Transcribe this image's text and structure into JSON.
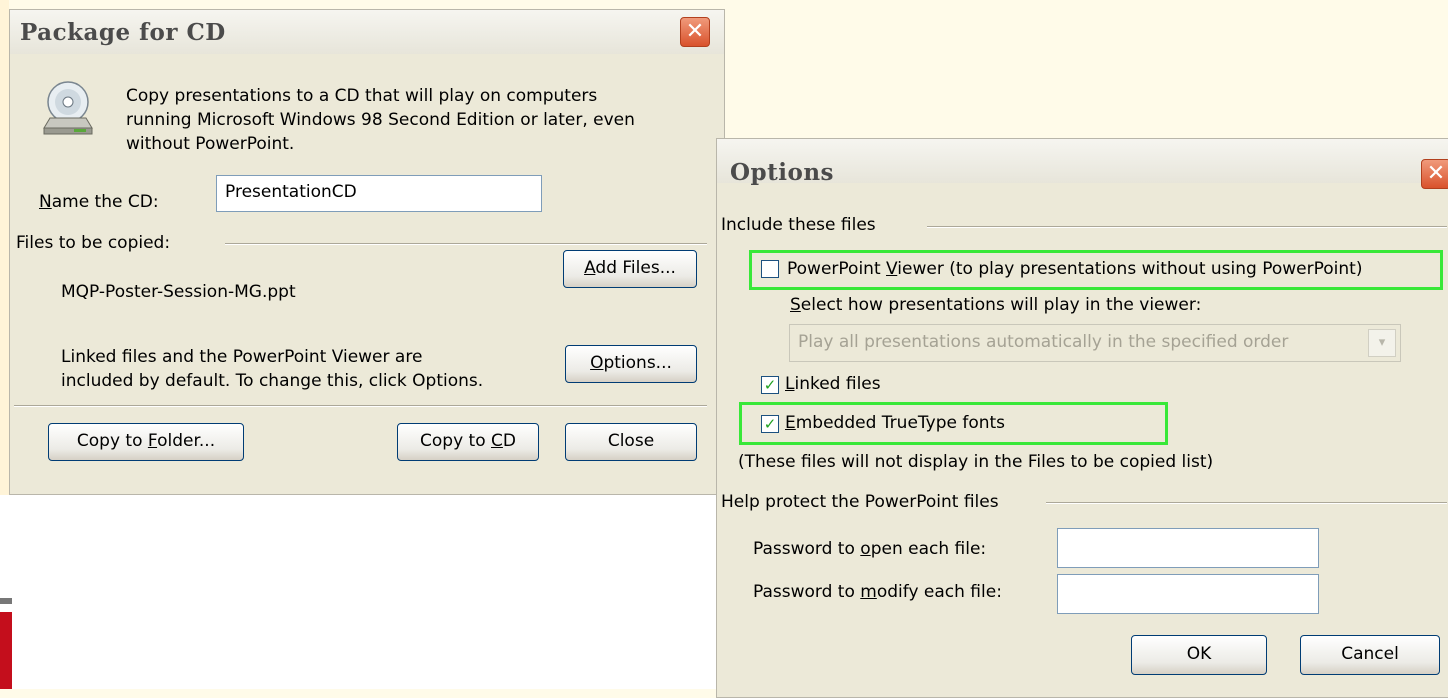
{
  "package_dialog": {
    "title": "Package for CD",
    "close_glyph": "✕",
    "icon": "cd-drive-icon",
    "description_line1": "Copy presentations to a CD that will play on computers",
    "description_line2": "running Microsoft Windows 98 Second Edition or later, even",
    "description_line3": "without PowerPoint.",
    "name_label_u": "N",
    "name_label_rest": "ame the CD:",
    "name_value": "PresentationCD",
    "files_label": "Files to be copied:",
    "file_name": "MQP-Poster-Session-MG.ppt",
    "add_files_u": "A",
    "add_files_rest": "dd Files...",
    "linked_info_line1": "Linked files and the PowerPoint Viewer are",
    "linked_info_line2": "included by default. To change this, click Options.",
    "options_u": "O",
    "options_rest": "ptions...",
    "copy_folder_pre": "Copy to ",
    "copy_folder_u": "F",
    "copy_folder_post": "older...",
    "copy_cd_pre": "Copy to ",
    "copy_cd_u": "C",
    "copy_cd_post": "D",
    "close_label": "Close"
  },
  "options_dialog": {
    "title": "Options",
    "close_glyph": "✕",
    "include_group": "Include these files",
    "viewer_pre": "PowerPoint ",
    "viewer_u": "V",
    "viewer_post": "iewer (to play presentations without using PowerPoint)",
    "viewer_checked": false,
    "select_how_u": "S",
    "select_how_rest": "elect how presentations will play in the viewer:",
    "play_mode": "Play all presentations automatically in the specified order",
    "linked_u": "L",
    "linked_rest": "inked files",
    "linked_checked": true,
    "fonts_u": "E",
    "fonts_rest": "mbedded TrueType fonts",
    "fonts_checked": true,
    "note": "(These files will not display in the Files to be copied list)",
    "protect_group": "Help protect the PowerPoint files",
    "pw_open_pre": "Password to ",
    "pw_open_u": "o",
    "pw_open_post": "pen each file:",
    "pw_modify_pre": "Password to ",
    "pw_modify_u": "m",
    "pw_modify_post": "odify each file:",
    "ok_label": "OK",
    "cancel_label": "Cancel",
    "checkmark": "✓",
    "dropdown_glyph": "▾"
  },
  "colors": {
    "dialog_bg": "#ece9d8",
    "highlight_green": "#38e838",
    "close_red": "#d9522c"
  }
}
